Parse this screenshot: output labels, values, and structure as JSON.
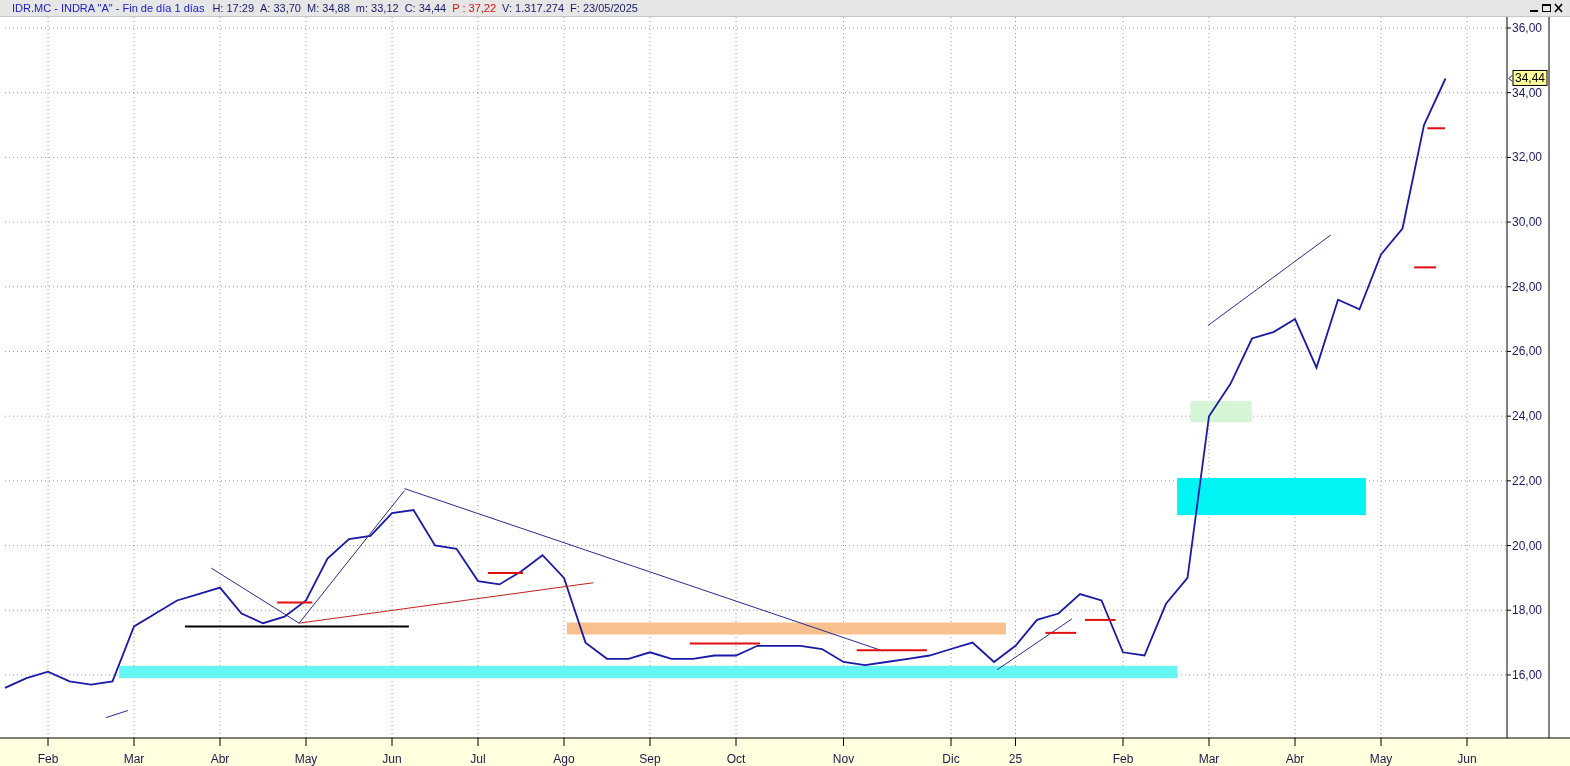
{
  "header": {
    "title": "IDR.MC - INDRA \"A\" - Fin de día 1 días",
    "fields": [
      {
        "text": "H: 17:29",
        "highlighted": false
      },
      {
        "text": "A: 33,70",
        "highlighted": false
      },
      {
        "text": "M: 34,88",
        "highlighted": false
      },
      {
        "text": "m: 33,12",
        "highlighted": false
      },
      {
        "text": "C: 34,44",
        "highlighted": false
      },
      {
        "text": "P : 37,22",
        "highlighted": true
      },
      {
        "text": "V: 1.317.274",
        "highlighted": false
      },
      {
        "text": "F: 23/05/2025",
        "highlighted": false
      }
    ]
  },
  "price_marker": {
    "label": "34,44"
  },
  "chart": {
    "chart_data": {
      "type": "line",
      "grid": true,
      "ylim": [
        14.05,
        36.34
      ],
      "categories": [
        null,
        null,
        "Feb",
        null,
        null,
        null,
        "Mar",
        null,
        null,
        null,
        "Abr",
        null,
        null,
        null,
        "May",
        null,
        null,
        null,
        "Jun",
        null,
        null,
        null,
        "Jul",
        null,
        null,
        null,
        "Ago",
        null,
        null,
        null,
        "Sep",
        null,
        null,
        null,
        "Oct",
        null,
        null,
        null,
        null,
        "Nov",
        null,
        null,
        null,
        null,
        "Dic",
        null,
        null,
        "25",
        null,
        null,
        null,
        null,
        "Feb",
        null,
        null,
        null,
        "Mar",
        null,
        null,
        null,
        "Abr",
        null,
        null,
        null,
        "May",
        null,
        null,
        null,
        "Jun"
      ],
      "yticks": [
        {
          "value": 16,
          "label": "16,00"
        },
        {
          "value": 18,
          "label": "18,00"
        },
        {
          "value": 20,
          "label": "20,00"
        },
        {
          "value": 22,
          "label": "22,00"
        },
        {
          "value": 24,
          "label": "24,00"
        },
        {
          "value": 26,
          "label": "26,00"
        },
        {
          "value": 28,
          "label": "28,00"
        },
        {
          "value": 30,
          "label": "30,00"
        },
        {
          "value": 32,
          "label": "32,00"
        },
        {
          "value": 34,
          "label": "34,00"
        },
        {
          "value": 36,
          "label": "36,00"
        }
      ],
      "series": [
        {
          "color": "#1a1aa8",
          "values": [
            15.6,
            15.9,
            16.1,
            15.8,
            15.7,
            15.8,
            17.5,
            17.9,
            18.3,
            18.5,
            18.7,
            17.9,
            17.6,
            17.8,
            18.3,
            19.6,
            20.2,
            20.3,
            21.0,
            21.1,
            20.0,
            19.9,
            18.9,
            18.8,
            19.2,
            19.7,
            19.0,
            17.0,
            16.5,
            16.5,
            16.7,
            16.5,
            16.5,
            16.6,
            16.6,
            16.9,
            16.9,
            16.9,
            16.8,
            16.4,
            16.3,
            16.4,
            16.5,
            16.6,
            16.8,
            17.0,
            16.4,
            16.9,
            17.7,
            17.9,
            18.5,
            18.3,
            16.7,
            16.6,
            18.2,
            19.0,
            24.0,
            25.0,
            26.4,
            26.6,
            27.0,
            25.5,
            27.6,
            27.3,
            29.0,
            29.8,
            33.0,
            34.44,
            null
          ]
        }
      ]
    }
  }
}
